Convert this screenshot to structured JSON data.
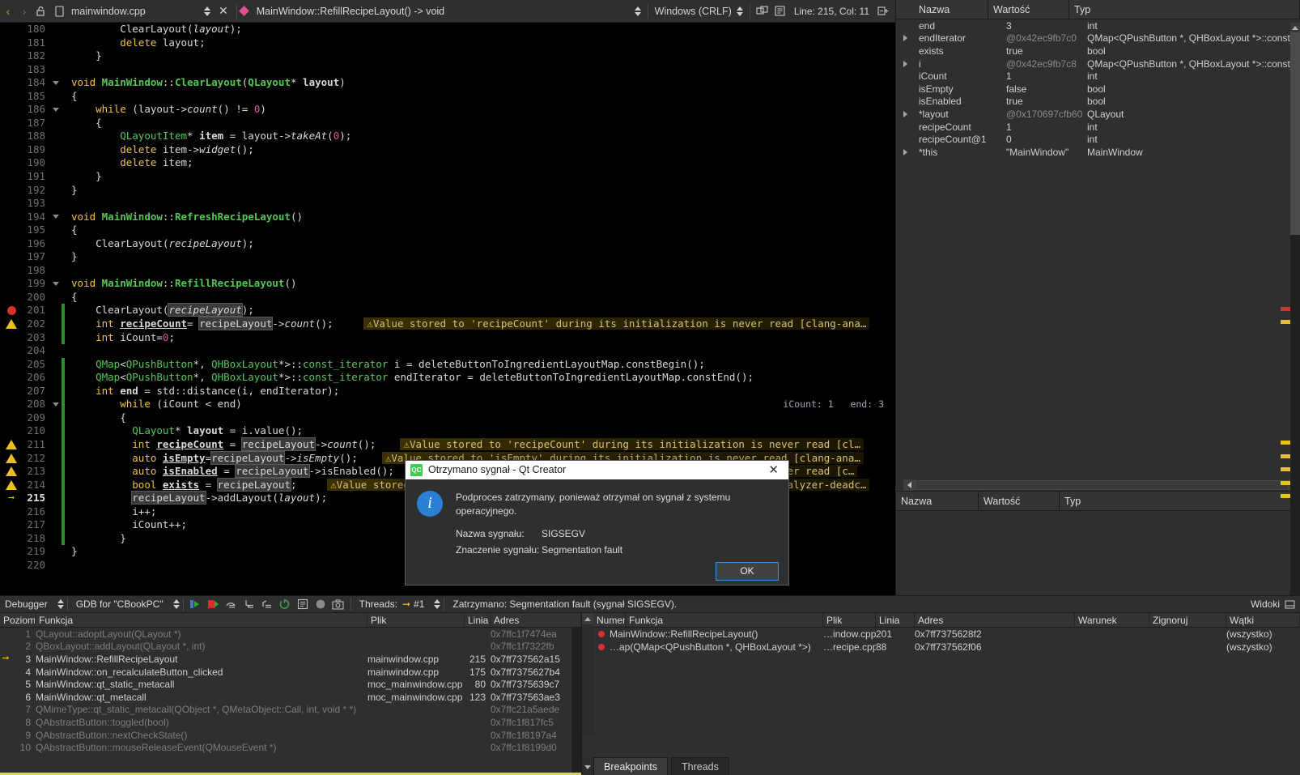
{
  "editor_toolbar": {
    "back_icon": "‹",
    "forward_icon": "›",
    "lock_icon": "unlock-icon",
    "file_icon": "file-icon",
    "filename": "mainwindow.cpp",
    "close_label": "✕",
    "symbol_marker": "diamond-marker",
    "symbol": "MainWindow::RefillRecipeLayout() -> void",
    "line_ending": "Windows (CRLF)",
    "split_icon": "split-icon",
    "wrap_icon": "text-wrap-icon",
    "cursor_position": "Line: 215, Col: 11",
    "collapse_icon": "collapse-all-icon"
  },
  "code": {
    "warning_full": "⚠Value stored to 'recipeCount' during its initialization is never read [clang-ana…",
    "inline_hint_208": "iCount: 1   end: 3",
    "lines": [
      {
        "n": 180,
        "mark": "",
        "fold": false,
        "bar": false
      },
      {
        "n": 181,
        "mark": "",
        "fold": false,
        "bar": false
      },
      {
        "n": 182,
        "mark": "",
        "fold": false,
        "bar": false
      },
      {
        "n": 183,
        "mark": "",
        "fold": false,
        "bar": false
      },
      {
        "n": 184,
        "mark": "",
        "fold": true,
        "bar": false
      },
      {
        "n": 185,
        "mark": "",
        "fold": false,
        "bar": false
      },
      {
        "n": 186,
        "mark": "",
        "fold": true,
        "bar": false
      },
      {
        "n": 187,
        "mark": "",
        "fold": false,
        "bar": false
      },
      {
        "n": 188,
        "mark": "",
        "fold": false,
        "bar": false
      },
      {
        "n": 189,
        "mark": "",
        "fold": false,
        "bar": false
      },
      {
        "n": 190,
        "mark": "",
        "fold": false,
        "bar": false
      },
      {
        "n": 191,
        "mark": "",
        "fold": false,
        "bar": false
      },
      {
        "n": 192,
        "mark": "",
        "fold": false,
        "bar": false
      },
      {
        "n": 193,
        "mark": "",
        "fold": false,
        "bar": false
      },
      {
        "n": 194,
        "mark": "",
        "fold": true,
        "bar": false
      },
      {
        "n": 195,
        "mark": "",
        "fold": false,
        "bar": false
      },
      {
        "n": 196,
        "mark": "",
        "fold": false,
        "bar": false
      },
      {
        "n": 197,
        "mark": "",
        "fold": false,
        "bar": false
      },
      {
        "n": 198,
        "mark": "",
        "fold": false,
        "bar": false
      },
      {
        "n": 199,
        "mark": "",
        "fold": true,
        "bar": false
      },
      {
        "n": 200,
        "mark": "",
        "fold": false,
        "bar": false
      },
      {
        "n": 201,
        "mark": "breakpoint",
        "fold": false,
        "bar": true
      },
      {
        "n": 202,
        "mark": "warning",
        "fold": false,
        "bar": true
      },
      {
        "n": 203,
        "mark": "",
        "fold": false,
        "bar": true
      },
      {
        "n": 204,
        "mark": "",
        "fold": false,
        "bar": false
      },
      {
        "n": 205,
        "mark": "",
        "fold": false,
        "bar": true
      },
      {
        "n": 206,
        "mark": "",
        "fold": false,
        "bar": true
      },
      {
        "n": 207,
        "mark": "",
        "fold": false,
        "bar": true
      },
      {
        "n": 208,
        "mark": "",
        "fold": true,
        "bar": true
      },
      {
        "n": 209,
        "mark": "",
        "fold": false,
        "bar": true
      },
      {
        "n": 210,
        "mark": "",
        "fold": false,
        "bar": true
      },
      {
        "n": 211,
        "mark": "warning",
        "fold": false,
        "bar": true
      },
      {
        "n": 212,
        "mark": "warning",
        "fold": false,
        "bar": true
      },
      {
        "n": 213,
        "mark": "warning",
        "fold": false,
        "bar": true
      },
      {
        "n": 214,
        "mark": "warning",
        "fold": false,
        "bar": true
      },
      {
        "n": 215,
        "mark": "current",
        "fold": false,
        "bar": true
      },
      {
        "n": 216,
        "mark": "",
        "fold": false,
        "bar": true
      },
      {
        "n": 217,
        "mark": "",
        "fold": false,
        "bar": true
      },
      {
        "n": 218,
        "mark": "",
        "fold": false,
        "bar": true
      },
      {
        "n": 219,
        "mark": "",
        "fold": false,
        "bar": false
      },
      {
        "n": 220,
        "mark": "",
        "fold": false,
        "bar": false
      }
    ]
  },
  "locals": {
    "columns": [
      "Nazwa",
      "Wartość",
      "Typ"
    ],
    "rows": [
      {
        "name": "end",
        "value": "3",
        "type": "int",
        "expand": false,
        "addr": false
      },
      {
        "name": "endIterator",
        "value": "@0x42ec9fb7c0",
        "type": "QMap<QPushButton *, QHBoxLayout *>::const_i",
        "expand": true,
        "addr": true
      },
      {
        "name": "exists",
        "value": "true",
        "type": "bool",
        "expand": false,
        "addr": false
      },
      {
        "name": "i",
        "value": "@0x42ec9fb7c8",
        "type": "QMap<QPushButton *, QHBoxLayout *>::const_i",
        "expand": true,
        "addr": true
      },
      {
        "name": "iCount",
        "value": "1",
        "type": "int",
        "expand": false,
        "addr": false
      },
      {
        "name": "isEmpty",
        "value": "false",
        "type": "bool",
        "expand": false,
        "addr": false
      },
      {
        "name": "isEnabled",
        "value": "true",
        "type": "bool",
        "expand": false,
        "addr": false
      },
      {
        "name": "*layout",
        "value": "@0x170697cfb60",
        "type": "QLayout",
        "expand": true,
        "addr": true
      },
      {
        "name": "recipeCount",
        "value": "1",
        "type": "int",
        "expand": false,
        "addr": false
      },
      {
        "name": "recipeCount@1",
        "value": "0",
        "type": "int",
        "expand": false,
        "addr": false
      },
      {
        "name": "*this",
        "value": "\"MainWindow\"",
        "type": "MainWindow",
        "expand": true,
        "addr": false
      }
    ]
  },
  "expressions": {
    "columns": [
      "Nazwa",
      "Wartość",
      "Typ"
    ],
    "rows": []
  },
  "debugger_toolbar": {
    "label": "Debugger",
    "engine": "GDB for \"CBookPC\"",
    "threads_label": "Threads:",
    "thread_value": "#1",
    "status": "Zatrzymano: Segmentation fault (sygnał SIGSEGV).",
    "views_label": "Widoki",
    "icons": [
      "continue-icon",
      "stop-icon",
      "step-over-icon",
      "step-into-icon",
      "step-out-icon",
      "restart-icon",
      "instruction-view-icon",
      "record-icon",
      "snapshot-icon"
    ]
  },
  "stack": {
    "columns": [
      "Poziom",
      "Funkcja",
      "Plik",
      "Linia",
      "Adres"
    ],
    "rows": [
      {
        "level": "1",
        "fn": "QLayout::adoptLayout(QLayout *)",
        "file": "",
        "line": "",
        "addr": "0x7ffc1f7474ea",
        "dim": true,
        "current": false
      },
      {
        "level": "2",
        "fn": "QBoxLayout::addLayout(QLayout *, int)",
        "file": "",
        "line": "",
        "addr": "0x7ffc1f7322fb",
        "dim": true,
        "current": false
      },
      {
        "level": "3",
        "fn": "MainWindow::RefillRecipeLayout",
        "file": "mainwindow.cpp",
        "line": "215",
        "addr": "0x7ff737562a15",
        "dim": false,
        "current": true
      },
      {
        "level": "4",
        "fn": "MainWindow::on_recalculateButton_clicked",
        "file": "mainwindow.cpp",
        "line": "175",
        "addr": "0x7ff7375627b4",
        "dim": false,
        "current": false
      },
      {
        "level": "5",
        "fn": "MainWindow::qt_static_metacall",
        "file": "moc_mainwindow.cpp",
        "line": "80",
        "addr": "0x7ff7375639c7",
        "dim": false,
        "current": false
      },
      {
        "level": "6",
        "fn": "MainWindow::qt_metacall",
        "file": "moc_mainwindow.cpp",
        "line": "123",
        "addr": "0x7ff737563ae3",
        "dim": false,
        "current": false
      },
      {
        "level": "7",
        "fn": "QMimeType::qt_static_metacall(QObject *, QMetaObject::Call, int, void * *)",
        "file": "",
        "line": "",
        "addr": "0x7ffc21a5aede",
        "dim": true,
        "current": false
      },
      {
        "level": "8",
        "fn": "QAbstractButton::toggled(bool)",
        "file": "",
        "line": "",
        "addr": "0x7ffc1f817fc5",
        "dim": true,
        "current": false
      },
      {
        "level": "9",
        "fn": "QAbstractButton::nextCheckState()",
        "file": "",
        "line": "",
        "addr": "0x7ffc1f8197a4",
        "dim": true,
        "current": false
      },
      {
        "level": "10",
        "fn": "QAbstractButton::mouseReleaseEvent(QMouseEvent *)",
        "file": "",
        "line": "",
        "addr": "0x7ffc1f8199d0",
        "dim": true,
        "current": false
      }
    ]
  },
  "breakpoints": {
    "columns": [
      "Numer",
      "Funkcja",
      "Plik",
      "Linia",
      "Adres",
      "Warunek",
      "Zignoruj",
      "Wątki"
    ],
    "rows": [
      {
        "fn": "MainWindow::RefillRecipeLayout()",
        "file": "…indow.cpp",
        "line": "201",
        "addr": "0x7ff7375628f2",
        "cond": "",
        "ignore": "",
        "threads": "(wszystko)"
      },
      {
        "fn": "…ap(QMap<QPushButton *, QHBoxLayout *>)",
        "file": "…recipe.cpp",
        "line": "88",
        "addr": "0x7ff737562f06",
        "cond": "",
        "ignore": "",
        "threads": "(wszystko)"
      }
    ],
    "tabs": [
      {
        "label": "Breakpoints",
        "active": true
      },
      {
        "label": "Threads",
        "active": false
      }
    ]
  },
  "dialog": {
    "logo_text": "QC",
    "title": "Otrzymano sygnał - Qt Creator",
    "close_label": "✕",
    "icon": "info-icon",
    "icon_glyph": "i",
    "message": "Podproces zatrzymany, ponieważ otrzymał on sygnał z systemu operacyjnego.",
    "signal_name_label": "Nazwa sygnału:",
    "signal_name_value": "SIGSEGV",
    "signal_meaning_label": "Znaczenie sygnału:",
    "signal_meaning_value": "Segmentation fault",
    "ok_label": "OK"
  },
  "colors": {
    "editor_bg": "#000000",
    "panel_bg": "#2e2f30",
    "breakpoint_red": "#d83030",
    "warning_yellow": "#e8c020",
    "current_line_green": "#2e8b2e",
    "accent_blue": "#4a90d9",
    "qt_green": "#41cd52"
  }
}
